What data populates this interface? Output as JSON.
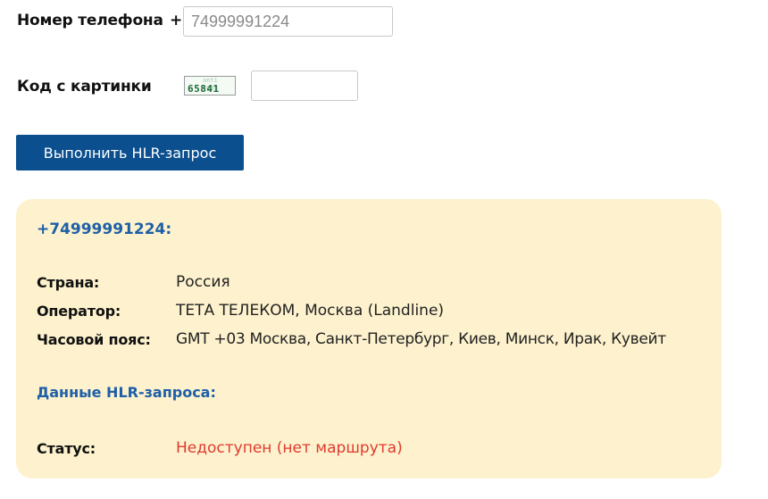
{
  "form": {
    "phone_label": "Номер телефона",
    "phone_prefix": "+",
    "phone_value": "74999991224",
    "captcha_label": "Код с картинки",
    "captcha_image_code": "65841",
    "captcha_image_noise": "anti spam",
    "captcha_input_value": "",
    "submit_label": "Выполнить HLR-запрос"
  },
  "result": {
    "phone_heading": "+74999991224:",
    "country_label": "Страна:",
    "country_value": "Россия",
    "operator_label": "Оператор:",
    "operator_value": "ТЕТА ТЕЛЕКОМ, Москва (Landline)",
    "timezone_label": "Часовой пояс:",
    "timezone_value": "GMT +03 Москва, Санкт-Петербург, Киев, Минск, Ирак, Кувейт",
    "hlr_section_title": "Данные HLR-запроса:",
    "status_label": "Статус:",
    "status_value": "Недоступен (нет маршрута)"
  },
  "colors": {
    "button_bg": "#0b4f8f",
    "panel_bg": "#fdf2cd",
    "link_blue": "#1e5fa8",
    "status_red": "#e03a2f"
  }
}
